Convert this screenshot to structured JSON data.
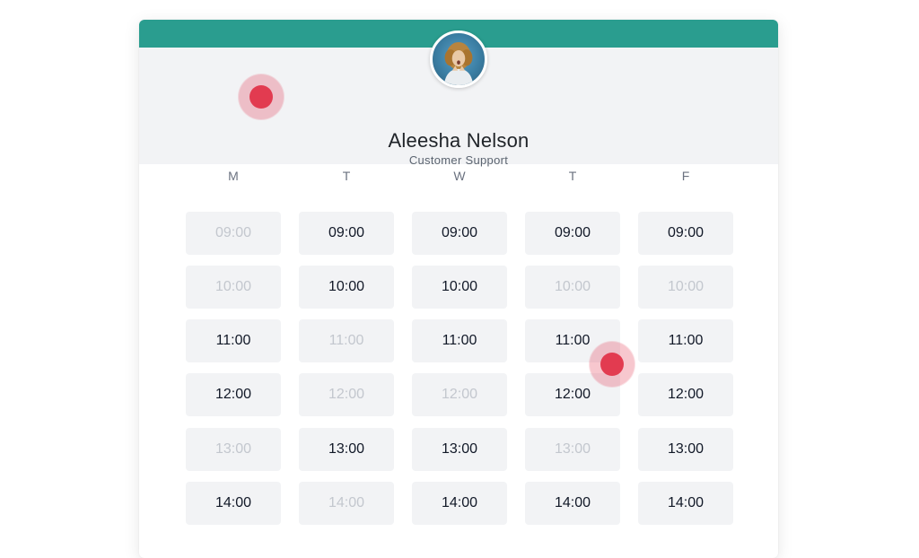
{
  "profile": {
    "name": "Aleesha Nelson",
    "role": "Customer Support",
    "avatar_icon": "person-avatar-icon"
  },
  "colors": {
    "accent": "#2a9d8f",
    "slot_bg": "#f2f3f5",
    "available_text": "#111827",
    "unavailable_text": "#c3c7ce",
    "marker": "#e23b50"
  },
  "days": [
    {
      "label": "M",
      "slots": [
        {
          "time": "09:00",
          "available": false
        },
        {
          "time": "10:00",
          "available": false
        },
        {
          "time": "11:00",
          "available": true
        },
        {
          "time": "12:00",
          "available": true
        },
        {
          "time": "13:00",
          "available": false
        },
        {
          "time": "14:00",
          "available": true
        }
      ]
    },
    {
      "label": "T",
      "slots": [
        {
          "time": "09:00",
          "available": true
        },
        {
          "time": "10:00",
          "available": true
        },
        {
          "time": "11:00",
          "available": false
        },
        {
          "time": "12:00",
          "available": false
        },
        {
          "time": "13:00",
          "available": true
        },
        {
          "time": "14:00",
          "available": false
        }
      ]
    },
    {
      "label": "W",
      "slots": [
        {
          "time": "09:00",
          "available": true
        },
        {
          "time": "10:00",
          "available": true
        },
        {
          "time": "11:00",
          "available": true
        },
        {
          "time": "12:00",
          "available": false
        },
        {
          "time": "13:00",
          "available": true
        },
        {
          "time": "14:00",
          "available": true
        }
      ]
    },
    {
      "label": "T",
      "slots": [
        {
          "time": "09:00",
          "available": true
        },
        {
          "time": "10:00",
          "available": false
        },
        {
          "time": "11:00",
          "available": true
        },
        {
          "time": "12:00",
          "available": true
        },
        {
          "time": "13:00",
          "available": false
        },
        {
          "time": "14:00",
          "available": true
        }
      ]
    },
    {
      "label": "F",
      "slots": [
        {
          "time": "09:00",
          "available": true
        },
        {
          "time": "10:00",
          "available": false
        },
        {
          "time": "11:00",
          "available": true
        },
        {
          "time": "12:00",
          "available": true
        },
        {
          "time": "13:00",
          "available": true
        },
        {
          "time": "14:00",
          "available": true
        }
      ]
    }
  ]
}
